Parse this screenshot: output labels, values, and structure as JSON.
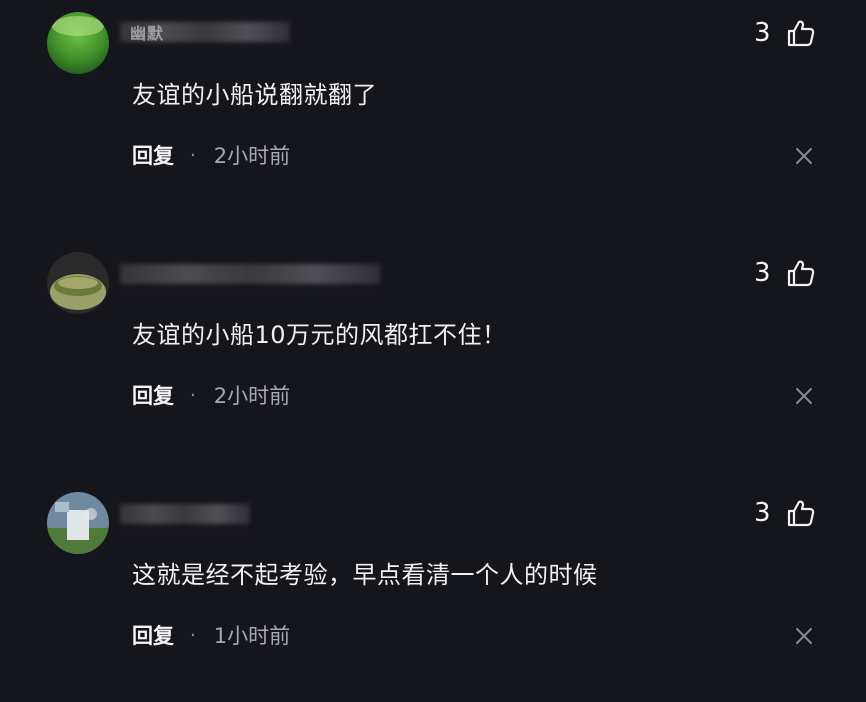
{
  "comments": [
    {
      "username": "幽默",
      "avatar": "green-avatar",
      "like_count": "3",
      "text": "友谊的小船说翻就翻了",
      "reply_label": "回复",
      "separator": "·",
      "time": "2小时前"
    },
    {
      "username": "",
      "avatar": "bowl-avatar",
      "like_count": "3",
      "text": "友谊的小船10万元的风都扛不住！",
      "reply_label": "回复",
      "separator": "·",
      "time": "2小时前"
    },
    {
      "username": "",
      "avatar": "outdoor-avatar",
      "like_count": "3",
      "text": "这就是经不起考验，早点看清一个人的时候",
      "reply_label": "回复",
      "separator": "·",
      "time": "1小时前"
    }
  ],
  "icons": {
    "like": "thumbs-up-icon",
    "close": "close-icon"
  },
  "colors": {
    "background": "#15151c",
    "text": "#f0f0f0",
    "muted": "#a8a8b0"
  }
}
